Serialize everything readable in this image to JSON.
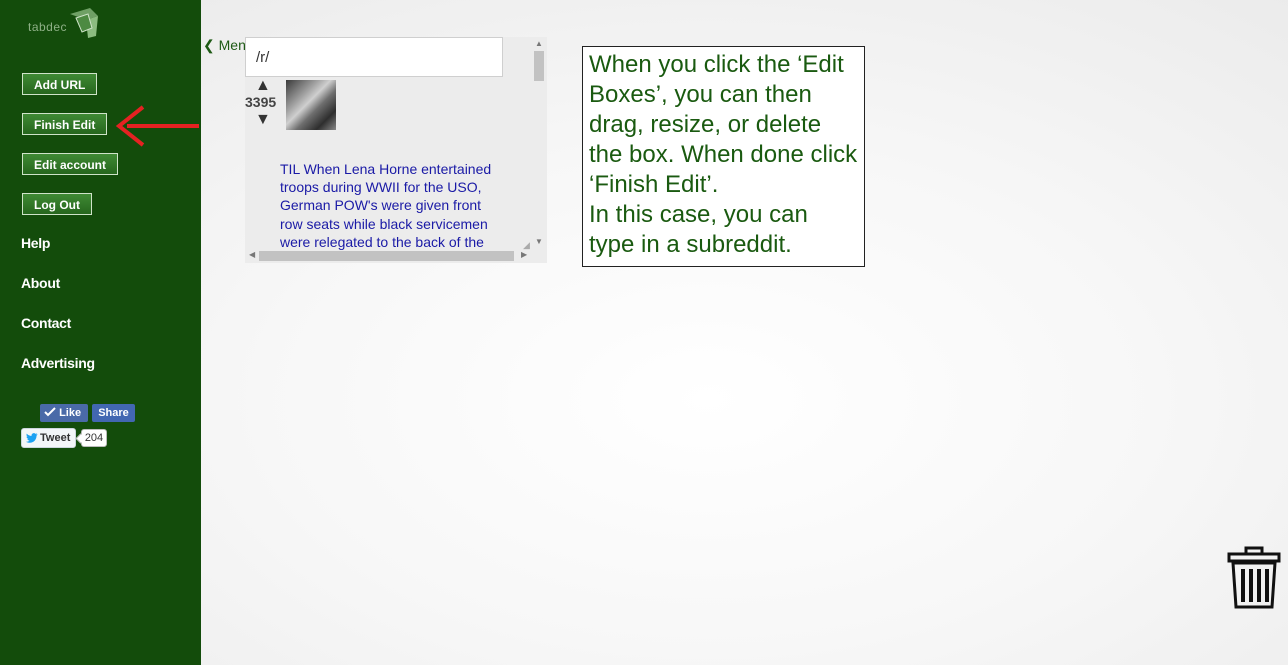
{
  "sidebar": {
    "logo_text": "tabdec",
    "buttons": {
      "add_url": "Add URL",
      "finish_edit": "Finish Edit",
      "edit_account": "Edit account",
      "log_out": "Log Out"
    },
    "links": {
      "help": "Help",
      "about": "About",
      "contact": "Contact",
      "advertising": "Advertising"
    },
    "social": {
      "like": "Like",
      "share": "Share",
      "tweet": "Tweet",
      "tweet_count": "204"
    }
  },
  "menu_toggle": "❮ Menu",
  "widget": {
    "subreddit_value": "/r/",
    "score": "3395",
    "post_title": "TIL When Lena Horne entertained troops during WWII for the USO, German POW's were given front row seats while black servicemen were relegated to the back of the"
  },
  "info_box": {
    "line1": "When you click the ‘Edit Boxes’, you can then drag, resize, or delete the box. When done click ‘Finish Edit’.",
    "line2": "In this case, you can type in a subreddit."
  },
  "colors": {
    "sidebar": "#134c0b",
    "button": "#2f7526",
    "link_blue": "#1a1aa6",
    "info_text": "#1a5a10",
    "arrow": "#e52222"
  },
  "icons": [
    "logo-icon",
    "arrow-pointer-icon",
    "like-check-icon",
    "twitter-bird-icon",
    "trash-icon",
    "vote-up-icon",
    "vote-down-icon"
  ]
}
